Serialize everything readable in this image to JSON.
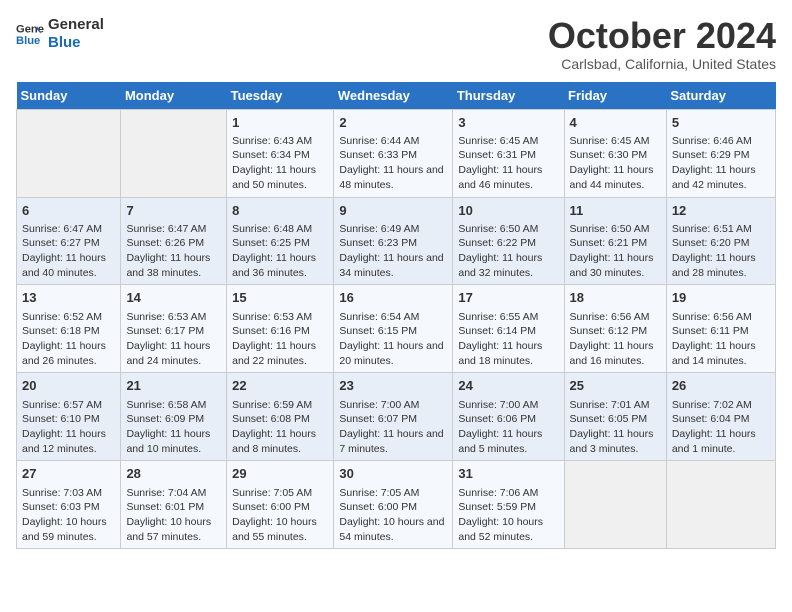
{
  "header": {
    "logo_line1": "General",
    "logo_line2": "Blue",
    "month": "October 2024",
    "location": "Carlsbad, California, United States"
  },
  "days_of_week": [
    "Sunday",
    "Monday",
    "Tuesday",
    "Wednesday",
    "Thursday",
    "Friday",
    "Saturday"
  ],
  "weeks": [
    [
      {
        "day": null,
        "content": ""
      },
      {
        "day": null,
        "content": ""
      },
      {
        "day": "1",
        "content": "Sunrise: 6:43 AM\nSunset: 6:34 PM\nDaylight: 11 hours and 50 minutes."
      },
      {
        "day": "2",
        "content": "Sunrise: 6:44 AM\nSunset: 6:33 PM\nDaylight: 11 hours and 48 minutes."
      },
      {
        "day": "3",
        "content": "Sunrise: 6:45 AM\nSunset: 6:31 PM\nDaylight: 11 hours and 46 minutes."
      },
      {
        "day": "4",
        "content": "Sunrise: 6:45 AM\nSunset: 6:30 PM\nDaylight: 11 hours and 44 minutes."
      },
      {
        "day": "5",
        "content": "Sunrise: 6:46 AM\nSunset: 6:29 PM\nDaylight: 11 hours and 42 minutes."
      }
    ],
    [
      {
        "day": "6",
        "content": "Sunrise: 6:47 AM\nSunset: 6:27 PM\nDaylight: 11 hours and 40 minutes."
      },
      {
        "day": "7",
        "content": "Sunrise: 6:47 AM\nSunset: 6:26 PM\nDaylight: 11 hours and 38 minutes."
      },
      {
        "day": "8",
        "content": "Sunrise: 6:48 AM\nSunset: 6:25 PM\nDaylight: 11 hours and 36 minutes."
      },
      {
        "day": "9",
        "content": "Sunrise: 6:49 AM\nSunset: 6:23 PM\nDaylight: 11 hours and 34 minutes."
      },
      {
        "day": "10",
        "content": "Sunrise: 6:50 AM\nSunset: 6:22 PM\nDaylight: 11 hours and 32 minutes."
      },
      {
        "day": "11",
        "content": "Sunrise: 6:50 AM\nSunset: 6:21 PM\nDaylight: 11 hours and 30 minutes."
      },
      {
        "day": "12",
        "content": "Sunrise: 6:51 AM\nSunset: 6:20 PM\nDaylight: 11 hours and 28 minutes."
      }
    ],
    [
      {
        "day": "13",
        "content": "Sunrise: 6:52 AM\nSunset: 6:18 PM\nDaylight: 11 hours and 26 minutes."
      },
      {
        "day": "14",
        "content": "Sunrise: 6:53 AM\nSunset: 6:17 PM\nDaylight: 11 hours and 24 minutes."
      },
      {
        "day": "15",
        "content": "Sunrise: 6:53 AM\nSunset: 6:16 PM\nDaylight: 11 hours and 22 minutes."
      },
      {
        "day": "16",
        "content": "Sunrise: 6:54 AM\nSunset: 6:15 PM\nDaylight: 11 hours and 20 minutes."
      },
      {
        "day": "17",
        "content": "Sunrise: 6:55 AM\nSunset: 6:14 PM\nDaylight: 11 hours and 18 minutes."
      },
      {
        "day": "18",
        "content": "Sunrise: 6:56 AM\nSunset: 6:12 PM\nDaylight: 11 hours and 16 minutes."
      },
      {
        "day": "19",
        "content": "Sunrise: 6:56 AM\nSunset: 6:11 PM\nDaylight: 11 hours and 14 minutes."
      }
    ],
    [
      {
        "day": "20",
        "content": "Sunrise: 6:57 AM\nSunset: 6:10 PM\nDaylight: 11 hours and 12 minutes."
      },
      {
        "day": "21",
        "content": "Sunrise: 6:58 AM\nSunset: 6:09 PM\nDaylight: 11 hours and 10 minutes."
      },
      {
        "day": "22",
        "content": "Sunrise: 6:59 AM\nSunset: 6:08 PM\nDaylight: 11 hours and 8 minutes."
      },
      {
        "day": "23",
        "content": "Sunrise: 7:00 AM\nSunset: 6:07 PM\nDaylight: 11 hours and 7 minutes."
      },
      {
        "day": "24",
        "content": "Sunrise: 7:00 AM\nSunset: 6:06 PM\nDaylight: 11 hours and 5 minutes."
      },
      {
        "day": "25",
        "content": "Sunrise: 7:01 AM\nSunset: 6:05 PM\nDaylight: 11 hours and 3 minutes."
      },
      {
        "day": "26",
        "content": "Sunrise: 7:02 AM\nSunset: 6:04 PM\nDaylight: 11 hours and 1 minute."
      }
    ],
    [
      {
        "day": "27",
        "content": "Sunrise: 7:03 AM\nSunset: 6:03 PM\nDaylight: 10 hours and 59 minutes."
      },
      {
        "day": "28",
        "content": "Sunrise: 7:04 AM\nSunset: 6:01 PM\nDaylight: 10 hours and 57 minutes."
      },
      {
        "day": "29",
        "content": "Sunrise: 7:05 AM\nSunset: 6:00 PM\nDaylight: 10 hours and 55 minutes."
      },
      {
        "day": "30",
        "content": "Sunrise: 7:05 AM\nSunset: 6:00 PM\nDaylight: 10 hours and 54 minutes."
      },
      {
        "day": "31",
        "content": "Sunrise: 7:06 AM\nSunset: 5:59 PM\nDaylight: 10 hours and 52 minutes."
      },
      {
        "day": null,
        "content": ""
      },
      {
        "day": null,
        "content": ""
      }
    ]
  ]
}
